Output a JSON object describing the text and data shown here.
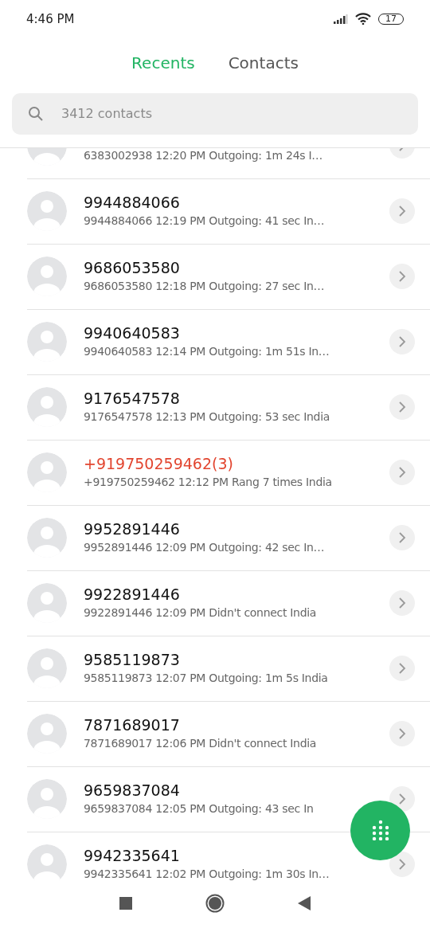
{
  "status_bar": {
    "time": "4:46 PM",
    "battery": "17"
  },
  "tabs": [
    {
      "label": "Recents",
      "selected": true
    },
    {
      "label": "Contacts",
      "selected": false
    }
  ],
  "search": {
    "placeholder": "3412 contacts"
  },
  "calls": [
    {
      "kind": "normal",
      "detail": "6383002938  12:20 PM Outgoing: 1m 24s  I…"
    },
    {
      "kind": "normal",
      "name": "9944884066",
      "detail": "9944884066  12:19 PM Outgoing: 41 sec  In…"
    },
    {
      "kind": "normal",
      "name": "9686053580",
      "detail": "9686053580  12:18 PM Outgoing: 27 sec  In…"
    },
    {
      "kind": "normal",
      "name": "9940640583",
      "detail": "9940640583  12:14 PM Outgoing: 1m 51s  In…"
    },
    {
      "kind": "normal",
      "name": "9176547578",
      "detail": "9176547578  12:13 PM Outgoing: 53 sec  India"
    },
    {
      "kind": "missed",
      "name": "+919750259462(3)",
      "detail": "+919750259462  12:12 PM Rang 7 times  India"
    },
    {
      "kind": "normal",
      "name": "9952891446",
      "detail": "9952891446  12:09 PM Outgoing: 42 sec  In…"
    },
    {
      "kind": "normal",
      "name": "9922891446",
      "detail": "9922891446  12:09 PM Didn't connect  India"
    },
    {
      "kind": "normal",
      "name": "9585119873",
      "detail": "9585119873  12:07 PM Outgoing: 1m 5s  India"
    },
    {
      "kind": "normal",
      "name": "7871689017",
      "detail": "7871689017  12:06 PM Didn't connect  India"
    },
    {
      "kind": "normal",
      "name": "9659837084",
      "detail": "9659837084  12:05 PM Outgoing: 43 sec  In"
    },
    {
      "kind": "normal",
      "name": "9942335641",
      "detail": "9942335641  12:02 PM Outgoing: 1m 30s  In…"
    }
  ]
}
